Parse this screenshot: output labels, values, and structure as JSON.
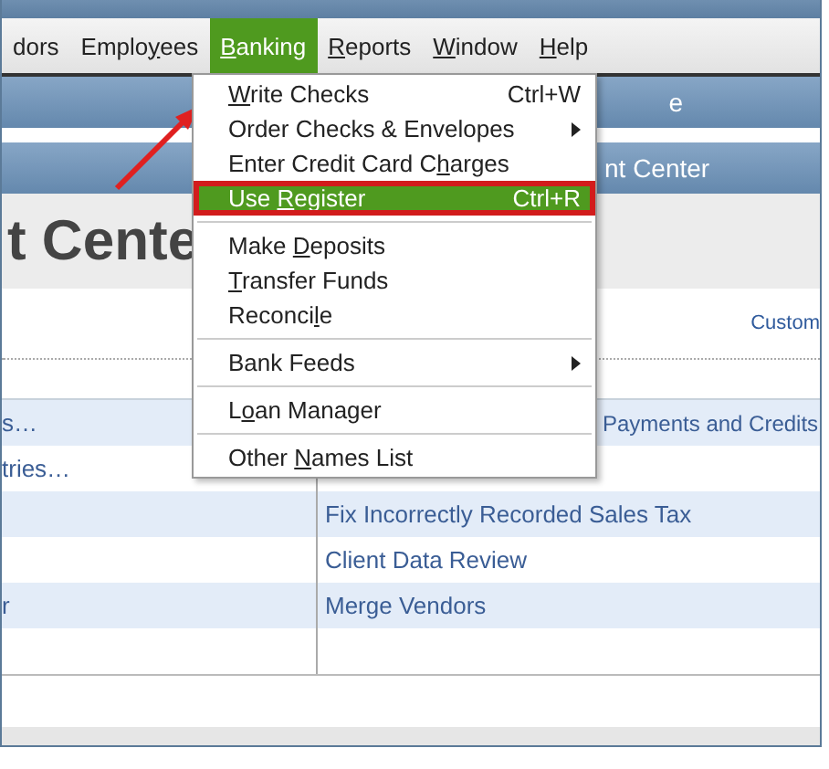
{
  "menu_bar": [
    {
      "pre": "dors",
      "selected": false
    },
    {
      "pre": "Emplo",
      "key": "y",
      "post": "ees",
      "selected": false
    },
    {
      "key": "B",
      "post": "anking",
      "selected": true
    },
    {
      "key": "R",
      "post": "eports",
      "selected": false
    },
    {
      "key": "W",
      "post": "indow",
      "selected": false
    },
    {
      "key": "H",
      "post": "elp",
      "selected": false
    }
  ],
  "header_bars": [
    {
      "text": "e"
    },
    {
      "text": "nt Center"
    }
  ],
  "heading": "t Cente",
  "custom_link": "Custom",
  "rows": [
    {
      "left": "s…",
      "right": "Payments and Credits"
    },
    {
      "left": "tries…"
    },
    {
      "right": "Fix Incorrectly Recorded Sales Tax"
    },
    {
      "right": "Client Data Review"
    },
    {
      "left": "r",
      "right": "Merge Vendors"
    },
    {}
  ],
  "banking_menu": [
    {
      "kind": "item",
      "key": "W",
      "post": "rite Checks",
      "shortcut": "Ctrl+W",
      "submenu": false,
      "selected": false
    },
    {
      "kind": "item",
      "pre": "Order Checks & Envelopes",
      "submenu": true,
      "selected": false
    },
    {
      "kind": "item",
      "pre": "Enter Credit Card C",
      "key": "h",
      "post": "arges",
      "submenu": false,
      "selected": false
    },
    {
      "kind": "item",
      "pre": "Use ",
      "key": "R",
      "post": "egister",
      "shortcut": "Ctrl+R",
      "submenu": false,
      "selected": true
    },
    {
      "kind": "separator"
    },
    {
      "kind": "item",
      "pre": "Make ",
      "key": "D",
      "post": "eposits",
      "submenu": false,
      "selected": false
    },
    {
      "kind": "item",
      "key": "T",
      "post": "ransfer Funds",
      "submenu": false,
      "selected": false
    },
    {
      "kind": "item",
      "pre": "Reconci",
      "key": "l",
      "post": "e",
      "submenu": false,
      "selected": false
    },
    {
      "kind": "separator"
    },
    {
      "kind": "item",
      "pre": "Bank Feeds",
      "submenu": true,
      "selected": false
    },
    {
      "kind": "separator"
    },
    {
      "kind": "item",
      "pre": "L",
      "key": "o",
      "post": "an Manager",
      "submenu": false,
      "selected": false
    },
    {
      "kind": "separator"
    },
    {
      "kind": "item",
      "pre": "Other ",
      "key": "N",
      "post": "ames List",
      "submenu": false,
      "selected": false
    }
  ]
}
